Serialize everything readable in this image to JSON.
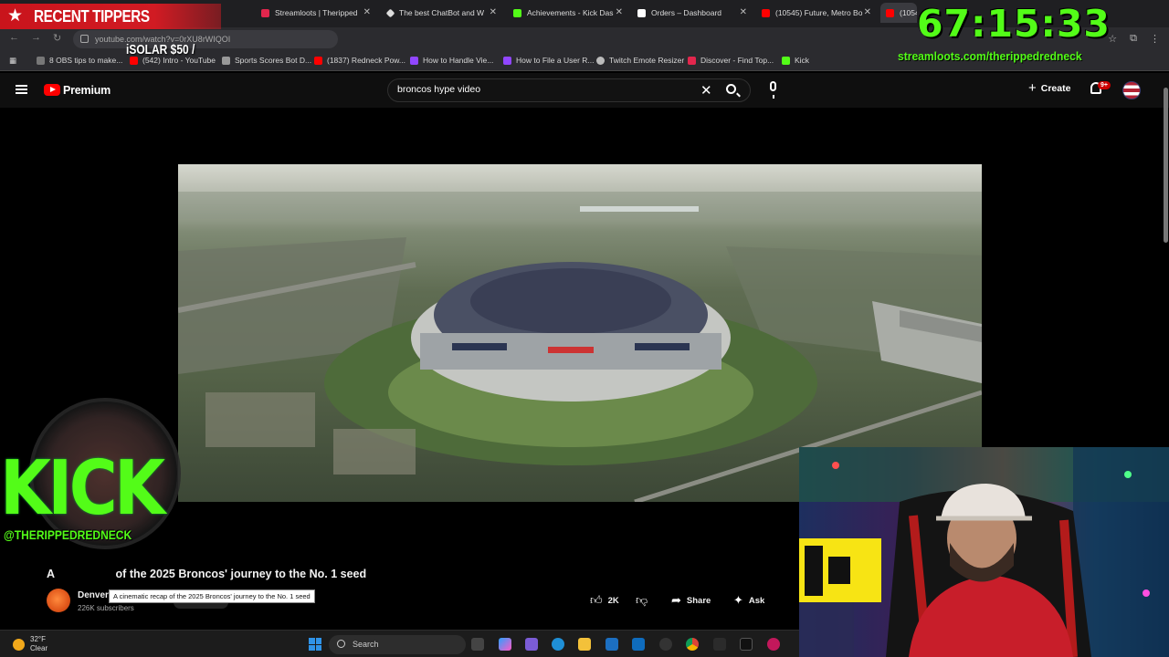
{
  "browser": {
    "tabs": [
      {
        "label": "Streamloots | Theripped"
      },
      {
        "label": "The best ChatBot and W"
      },
      {
        "label": "Achievements - Kick Das"
      },
      {
        "label": "Orders – Dashboard"
      },
      {
        "label": "(10545) Future, Metro Bo"
      },
      {
        "label": "(10545"
      }
    ],
    "url": "youtube.com/watch?v=0rXU8rWIQOI",
    "bookmarks": [
      {
        "label": "8 OBS tips to make..."
      },
      {
        "label": "(542) Intro - YouTube"
      },
      {
        "label": "Sports Scores Bot D..."
      },
      {
        "label": "(1837) Redneck Pow..."
      },
      {
        "label": "How to Handle Vie..."
      },
      {
        "label": "How to File a User R..."
      },
      {
        "label": "Twitch Emote Resizer"
      },
      {
        "label": "Discover - Find Top..."
      },
      {
        "label": "Kick"
      }
    ]
  },
  "youtube": {
    "brand": "Premium",
    "search_value": "broncos hype video",
    "create_label": "Create",
    "notification_count": "9+"
  },
  "video": {
    "title_start": "A",
    "title_rest": "of the 2025 Broncos' journey to the No. 1 seed",
    "channel": "Denver",
    "subscribers": "226K subscribers",
    "tooltip": "A cinematic recap of the 2025 Broncos' journey to the No. 1 seed",
    "actions": {
      "likes": "2K",
      "share": "Share",
      "ask": "Ask"
    }
  },
  "taskbar": {
    "temperature": "32°F",
    "condition": "Clear",
    "search_placeholder": "Search"
  },
  "overlays": {
    "recent_tippers": "RECENT TIPPERS",
    "tipper_entry": "iSOLAR $50 /",
    "timer": "67:15:33",
    "stream_url": "streamloots.com/therippedredneck",
    "kick_word": "KICK",
    "kick_handle": "@THERIPPEDREDNECK"
  },
  "colors": {
    "kick_green": "#53fc18",
    "youtube_red": "#ff0000",
    "tippers_red": "#d11b23"
  }
}
